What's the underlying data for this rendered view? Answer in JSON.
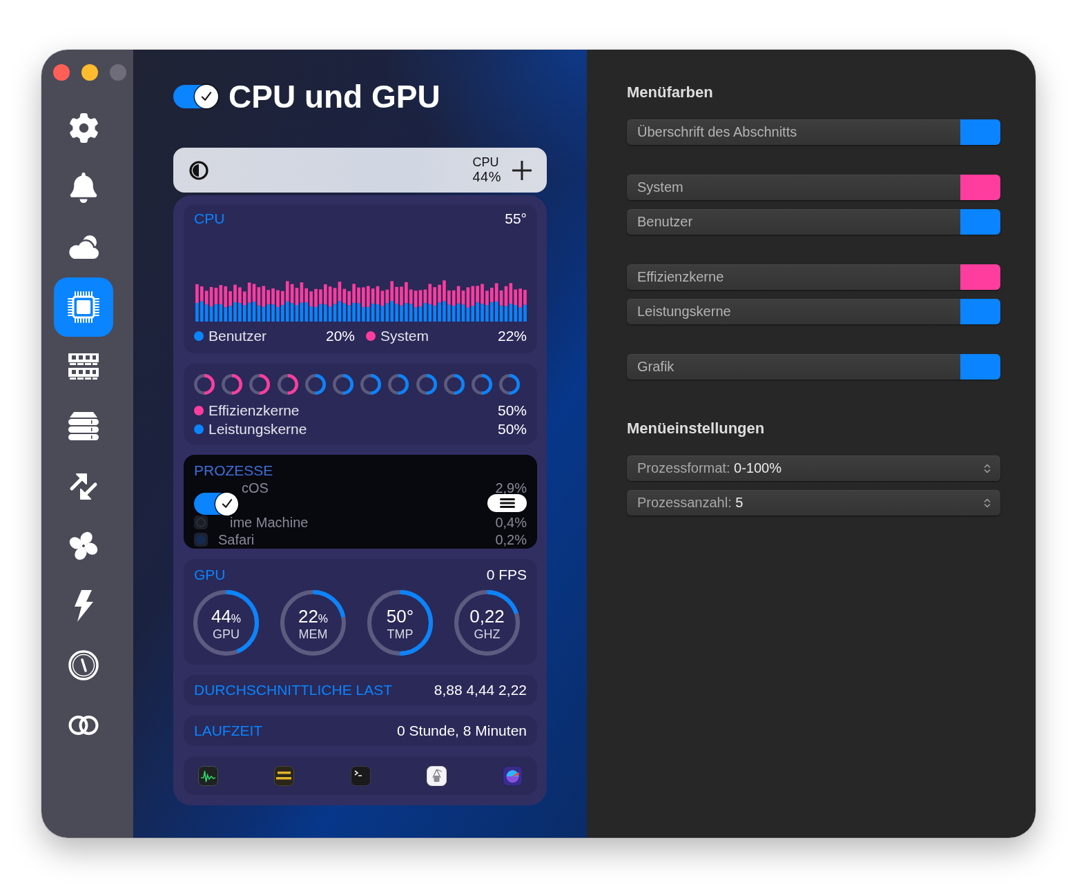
{
  "window": {
    "buttons": [
      {
        "kind": "close",
        "disabled": false
      },
      {
        "kind": "minimize",
        "disabled": false
      },
      {
        "kind": "zoom",
        "disabled": true
      }
    ]
  },
  "sidebar": {
    "items": [
      {
        "kind": "gear",
        "selected": false
      },
      {
        "kind": "bell",
        "selected": false
      },
      {
        "kind": "cloud",
        "selected": false
      },
      {
        "kind": "chip",
        "selected": true
      },
      {
        "kind": "memory",
        "selected": false
      },
      {
        "kind": "disk",
        "selected": false
      },
      {
        "kind": "arrows",
        "selected": false
      },
      {
        "kind": "fan",
        "selected": false
      },
      {
        "kind": "bolt",
        "selected": false
      },
      {
        "kind": "gauge",
        "selected": false
      },
      {
        "kind": "rings",
        "selected": false
      }
    ]
  },
  "header": {
    "title": "CPU und GPU",
    "enabled": true
  },
  "menu_preview": {
    "label": "CPU",
    "value": "44%"
  },
  "cpu": {
    "title": "CPU",
    "temperature": "55°",
    "legend": [
      {
        "label": "Benutzer",
        "value": "20%",
        "color": "#0a84ff"
      },
      {
        "label": "System",
        "value": "22%",
        "color": "#ff3d9e"
      }
    ]
  },
  "cores": {
    "rings": [
      {
        "color": "#ff3d9e",
        "level": 0.5
      },
      {
        "color": "#ff3d9e",
        "level": 0.5
      },
      {
        "color": "#ff3d9e",
        "level": 0.5
      },
      {
        "color": "#ff3d9e",
        "level": 0.5
      },
      {
        "color": "#0a84ff",
        "level": 0.5
      },
      {
        "color": "#0a84ff",
        "level": 0.5
      },
      {
        "color": "#0a84ff",
        "level": 0.5
      },
      {
        "color": "#0a84ff",
        "level": 0.5
      },
      {
        "color": "#0a84ff",
        "level": 0.5
      },
      {
        "color": "#0a84ff",
        "level": 0.5
      },
      {
        "color": "#0a84ff",
        "level": 0.5
      },
      {
        "color": "#0a84ff",
        "level": 0.5
      }
    ],
    "legend": [
      {
        "label": "Effizienzkerne",
        "value": "50%",
        "color": "#ff3d9e"
      },
      {
        "label": "Leistungskerne",
        "value": "50%",
        "color": "#0a84ff"
      }
    ]
  },
  "processes": {
    "title": "PROZESSE",
    "enabled": true,
    "rows": [
      {
        "kind": "covered",
        "name": "cOS",
        "value": "2,9%"
      },
      {
        "kind": "clock",
        "name": "ime Machine",
        "value": "0,4%"
      },
      {
        "kind": "compass",
        "name": "Safari",
        "value": "0,2%"
      }
    ]
  },
  "gpu": {
    "title": "GPU",
    "fps": "0 FPS",
    "gauges": [
      {
        "value": "44",
        "unit": "%",
        "label": "GPU",
        "level": 0.44
      },
      {
        "value": "22",
        "unit": "%",
        "label": "MEM",
        "level": 0.22
      },
      {
        "value": "50°",
        "label": "TMP",
        "level": 0.5
      },
      {
        "value": "0,22",
        "label": "GHZ",
        "level": 0.2
      }
    ]
  },
  "load": {
    "label": "DURCHSCHNITTLICHE LAST",
    "value": "8,88 4,44 2,22"
  },
  "uptime": {
    "label": "LAUFZEIT",
    "value": "0 Stunde, 8 Minuten"
  },
  "apps": [
    {
      "kind": "activity"
    },
    {
      "kind": "console"
    },
    {
      "kind": "terminal"
    },
    {
      "kind": "utility"
    },
    {
      "kind": "speedometer"
    }
  ],
  "menu_colors": {
    "title": "Menüfarben",
    "groups": [
      {
        "items": [
          {
            "label": "Überschrift des Abschnitts",
            "color": "#0a84ff"
          }
        ]
      },
      {
        "items": [
          {
            "label": "System",
            "color": "#ff3d9e"
          },
          {
            "label": "Benutzer",
            "color": "#0a84ff"
          }
        ]
      },
      {
        "items": [
          {
            "label": "Effizienzkerne",
            "color": "#ff3d9e"
          },
          {
            "label": "Leistungskerne",
            "color": "#0a84ff"
          }
        ]
      },
      {
        "items": [
          {
            "label": "Grafik",
            "color": "#0a84ff"
          }
        ]
      }
    ]
  },
  "menu_settings": {
    "title": "Menüeinstellungen",
    "popups": [
      {
        "label": "Prozessformat:",
        "value": "0-100%"
      },
      {
        "label": "Prozessanzahl:",
        "value": "5"
      }
    ]
  }
}
